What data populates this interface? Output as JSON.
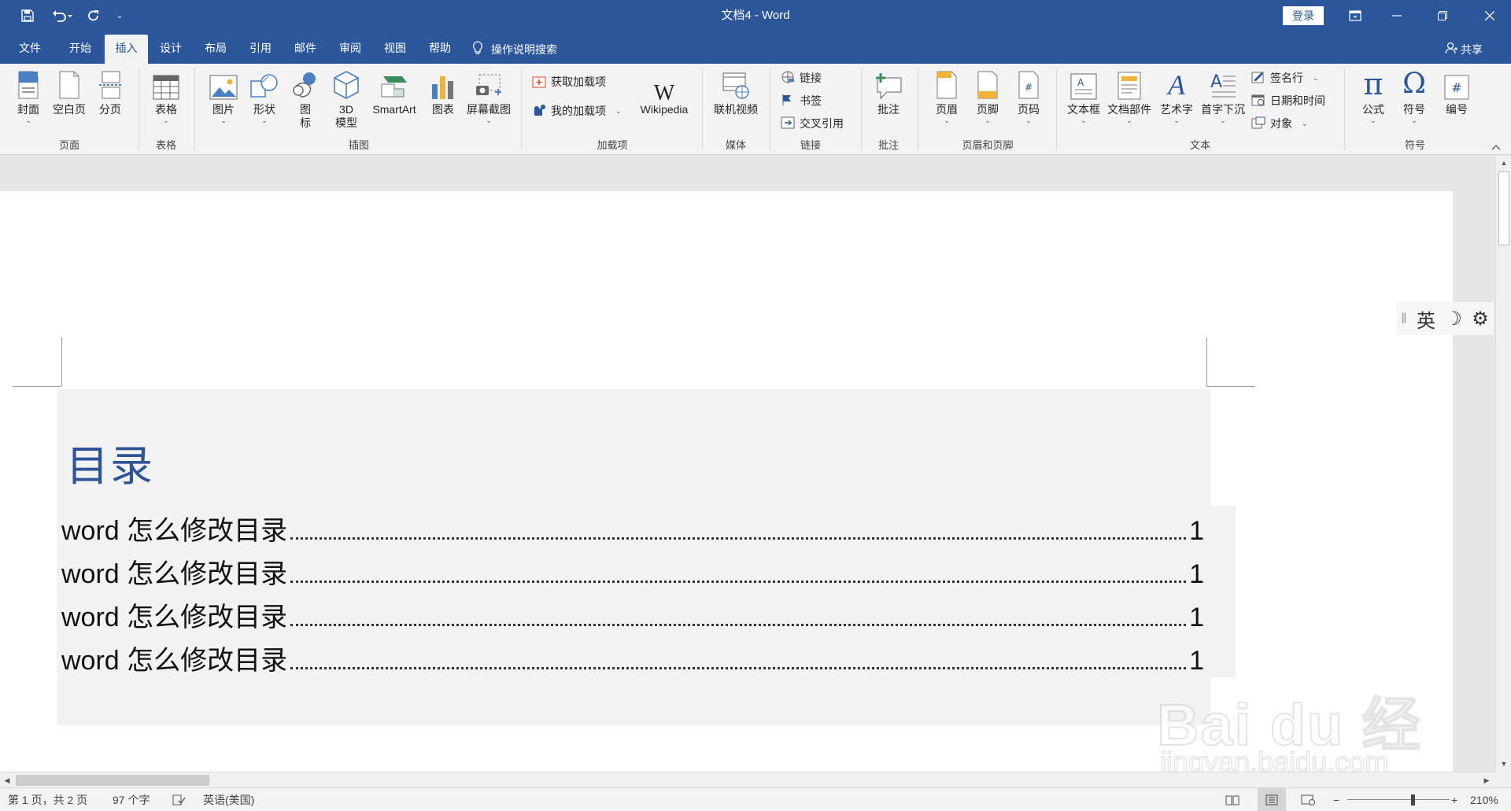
{
  "window": {
    "title": "文档4  -  Word",
    "login_label": "登录"
  },
  "qat": {
    "more": "⌄"
  },
  "tabs": [
    {
      "label": "文件"
    },
    {
      "label": "开始"
    },
    {
      "label": "插入"
    },
    {
      "label": "设计"
    },
    {
      "label": "布局"
    },
    {
      "label": "引用"
    },
    {
      "label": "邮件"
    },
    {
      "label": "审阅"
    },
    {
      "label": "视图"
    },
    {
      "label": "帮助"
    }
  ],
  "active_tab": "插入",
  "tell_me": "操作说明搜索",
  "share": "共享",
  "ribbon": {
    "pages": {
      "cover": "封面",
      "blank": "空白页",
      "break": "分页",
      "group": "页面"
    },
    "tables": {
      "table": "表格",
      "group": "表格"
    },
    "illustrations": {
      "pictures": "图片",
      "shapes": "形状",
      "icons_1": "图",
      "icons_2": "标",
      "model_1": "3D",
      "model_2": "模型",
      "smartart": "SmartArt",
      "chart": "图表",
      "screenshot": "屏幕截图",
      "group": "插图"
    },
    "addins": {
      "get": "获取加载项",
      "mine": "我的加载项",
      "wikipedia": "Wikipedia",
      "group": "加载项"
    },
    "media": {
      "video": "联机视频",
      "group": "媒体"
    },
    "links": {
      "link": "链接",
      "bookmark": "书签",
      "crossref": "交叉引用",
      "group": "链接"
    },
    "comments": {
      "comment": "批注",
      "group": "批注"
    },
    "header_footer": {
      "header": "页眉",
      "footer": "页脚",
      "page_number": "页码",
      "group": "页眉和页脚"
    },
    "text": {
      "textbox": "文本框",
      "quickparts": "文档部件",
      "wordart": "艺术字",
      "dropcap": "首字下沉",
      "signature": "签名行",
      "datetime": "日期和时间",
      "object": "对象",
      "group": "文本"
    },
    "symbols": {
      "equation": "公式",
      "symbol": "符号",
      "number": "编号",
      "group": "符号"
    }
  },
  "document": {
    "toc_heading": "目录",
    "toc_entries": [
      {
        "text": "word 怎么修改目录",
        "page": "1"
      },
      {
        "text": "word 怎么修改目录",
        "page": "1"
      },
      {
        "text": "word 怎么修改目录",
        "page": "1"
      },
      {
        "text": "word 怎么修改目录",
        "page": "1"
      }
    ]
  },
  "ime": {
    "mode": "英",
    "moon": "☽",
    "settings": "⚙"
  },
  "watermark": {
    "brand": "Bai du 经验",
    "url": "jingyan.baidu.com"
  },
  "status": {
    "page": "第 1 页，共 2 页",
    "words": "97 个字",
    "language": "英语(美国)",
    "zoom": "210%",
    "zoom_minus": "−",
    "zoom_plus": "+"
  },
  "colors": {
    "brand": "#2b579a",
    "heading": "#2f5496"
  }
}
